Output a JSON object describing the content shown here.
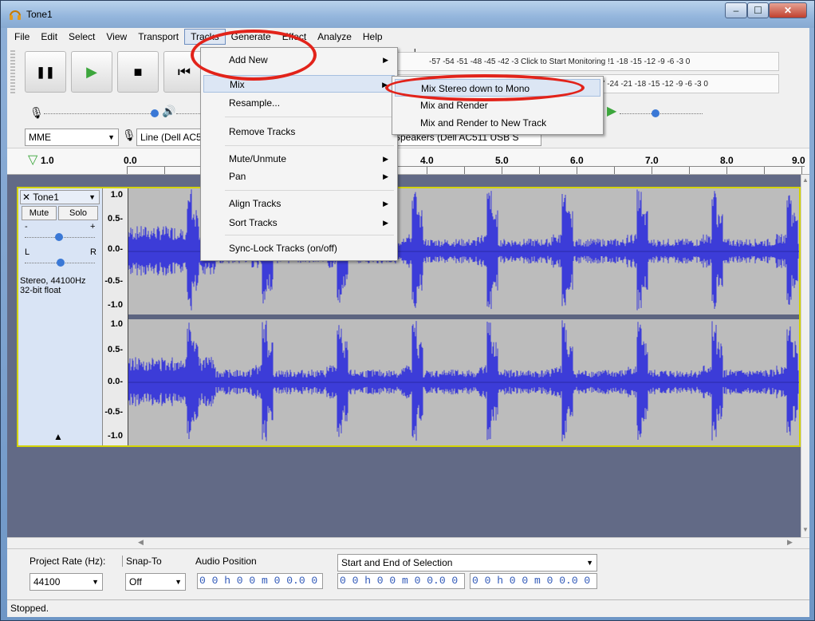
{
  "window": {
    "title": "Tone1",
    "min": "‒",
    "max": "☐",
    "close": "✕"
  },
  "menubar": [
    "File",
    "Edit",
    "Select",
    "View",
    "Transport",
    "Tracks",
    "Generate",
    "Effect",
    "Analyze",
    "Help"
  ],
  "transport": {
    "pause": "❚❚",
    "play": "▶",
    "stop": "■",
    "skip_start": "⏮"
  },
  "meters": {
    "record_lr": "L R",
    "record_scale": "-57 -54 -51 -48 -45 -42 -3  Click to Start Monitoring !1 -18 -15 -12  -9  -6  -3  0",
    "play_scale": "-27 -24 -21 -18 -15 -12  -9  -6  -3  0"
  },
  "device": {
    "host": "MME",
    "input": "Line (Dell AC5",
    "output": "Speakers (Dell AC511 USB S"
  },
  "ruler": {
    "start": "1.0",
    "ticks": [
      "0.0",
      "4.0",
      "5.0",
      "6.0",
      "7.0",
      "8.0",
      "9.0"
    ]
  },
  "track": {
    "name": "Tone1",
    "mute": "Mute",
    "solo": "Solo",
    "gain_minus": "-",
    "gain_plus": "+",
    "pan_l": "L",
    "pan_r": "R",
    "info1": "Stereo, 44100Hz",
    "info2": "32-bit float",
    "scale": [
      "1.0",
      "0.5-",
      "0.0-",
      "-0.5-",
      "-1.0"
    ]
  },
  "tracks_menu": {
    "items": [
      {
        "label": "Add New",
        "sub": true
      },
      {
        "label": "Mix",
        "sub": true
      },
      {
        "label": "Resample...",
        "sub": false
      },
      {
        "label": "Remove Tracks",
        "sub": false
      },
      {
        "label": "Mute/Unmute",
        "sub": true
      },
      {
        "label": "Pan",
        "sub": true
      },
      {
        "label": "Align Tracks",
        "sub": true
      },
      {
        "label": "Sort Tracks",
        "sub": true
      },
      {
        "label": "Sync-Lock Tracks (on/off)",
        "sub": false
      }
    ]
  },
  "mix_menu": {
    "items": [
      "Mix Stereo down to Mono",
      "Mix and Render",
      "Mix and Render to New Track"
    ]
  },
  "selection_toolbar": {
    "project_rate_label": "Project Rate (Hz):",
    "project_rate": "44100",
    "snap_label": "Snap-To",
    "snap_value": "Off",
    "audio_position_label": "Audio Position",
    "audio_position": "0 0 h 0 0 m 0 0.0 0 0 s",
    "selection_mode": "Start and End of Selection",
    "sel_start": "0 0 h 0 0 m 0 0.0 0 0 s",
    "sel_end": "0 0 h 0 0 m 0 0.0 0 0 s"
  },
  "status": "Stopped.",
  "colors": {
    "wave": "#3c3cd8",
    "highlight": "#e2231a",
    "selection_text": "#2f58b8"
  }
}
